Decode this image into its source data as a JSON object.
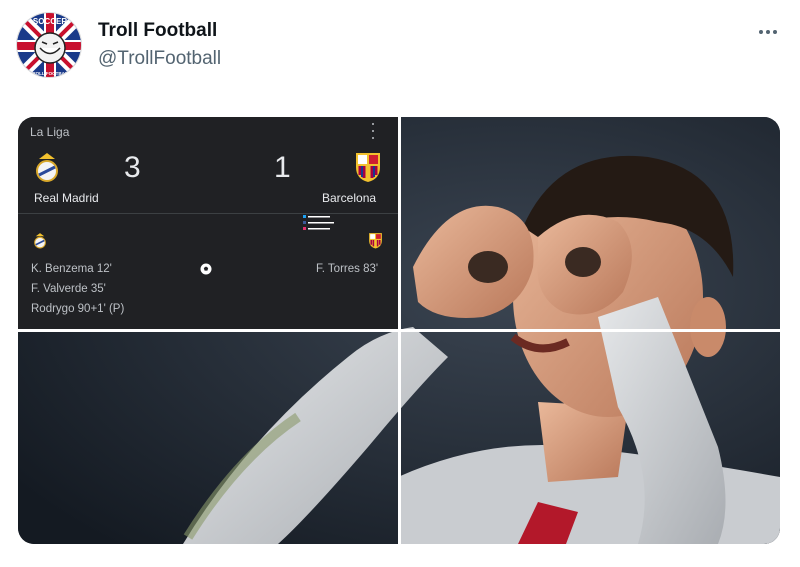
{
  "tweet": {
    "display_name": "Troll Football",
    "handle": "@TrollFootball",
    "more_icon": "more-horizontal-icon",
    "avatar": {
      "icon": "troll-face-union-jack-avatar",
      "logo_text": "SOCCER",
      "logo_subtext": "TROLL FOOTBALL"
    }
  },
  "match_card": {
    "league": "La Liga",
    "home": {
      "team": "Real Madrid",
      "score": "3",
      "crest_icon": "real-madrid-crest-icon",
      "scorers": [
        "K. Benzema 12'",
        "F. Valverde 35'",
        "Rodrygo 90+1' (P)"
      ]
    },
    "away": {
      "team": "Barcelona",
      "score": "1",
      "crest_icon": "barcelona-crest-icon",
      "scorers": [
        "F. Torres 83'"
      ]
    },
    "goal_icon": "soccer-ball-icon"
  },
  "photo": {
    "subject_icon": "player-goggles-celebration-photo"
  },
  "colors": {
    "card_bg": "#202124",
    "grid_lines": "#ffffff",
    "handle": "#536471"
  }
}
